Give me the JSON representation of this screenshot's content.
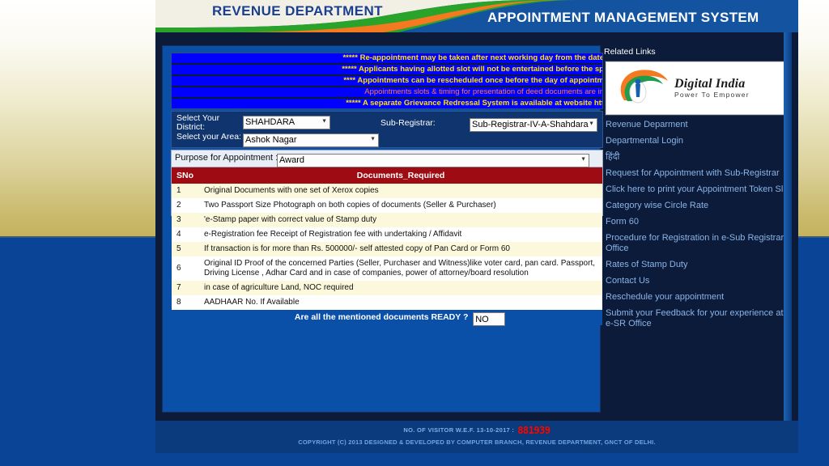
{
  "header": {
    "left_title": "REVENUE DEPARTMENT",
    "right_title": "APPOINTMENT MANAGEMENT SYSTEM"
  },
  "marquee": {
    "lines": [
      {
        "text": "***** Re-appointment may be taken after next working day from the date",
        "color": "#ffe400"
      },
      {
        "text": "***** Applicants having allotted slot will not be entertained before the sp",
        "color": "#ffe400"
      },
      {
        "text": "**** Appointments can be rescheduled once before the day of appointm",
        "color": "#ffe400"
      },
      {
        "text": "Appointments slots & timing for presentation of deed documents are in",
        "color": "#ff7b3d"
      },
      {
        "text": "***** A separate Grievance Redressal System is available at website htt",
        "color": "#ffe400"
      }
    ]
  },
  "selectors": {
    "district_label": "Select Your District:",
    "district_value": "SHAHDARA",
    "subregistrar_label": "Sub-Registrar:",
    "subregistrar_value": "Sub-Registrar-IV-A-Shahdara",
    "area_label": "Select your Area:",
    "area_value": "Ashok Nagar"
  },
  "purpose": {
    "label": "Purpose for Appointment :",
    "value": "Award"
  },
  "documents_table": {
    "headers": [
      "SNo",
      "Documents_Required"
    ],
    "rows": [
      {
        "sno": "1",
        "doc": "Original Documents with one set of Xerox copies"
      },
      {
        "sno": "2",
        "doc": "Two Passport Size Photograph on both copies of documents (Seller & Purchaser)"
      },
      {
        "sno": "3",
        "doc": "'e-Stamp paper with correct value of Stamp duty"
      },
      {
        "sno": "4",
        "doc": "e-Registration fee Receipt of Registration fee with undertaking / Affidavit"
      },
      {
        "sno": "5",
        "doc": "If transaction is for more than Rs. 500000/- self attested copy of Pan Card or Form 60"
      },
      {
        "sno": "6",
        "doc": "Original ID Proof of the concerned Parties (Seller, Purchaser and Witness)like voter card, pan card. Passport, Driving License , Adhar Card and in case of companies, power of attorney/board resolution"
      },
      {
        "sno": "7",
        "doc": "in case of agriculture Land, NOC required"
      },
      {
        "sno": "8",
        "doc": "AADHAAR No. If Available"
      }
    ]
  },
  "ready": {
    "label": "Are all the  mentioned documents READY ?",
    "value": "NO"
  },
  "sidebar": {
    "title": "Related Links",
    "logo": {
      "name": "Digital India",
      "tagline": "Power To Empower"
    },
    "links": [
      {
        "label": "Revenue Deparment"
      },
      {
        "label": "Departmental Login"
      },
      {
        "label": "हिंदी"
      },
      {
        "label": "Request for Appointment with Sub-Registrar"
      },
      {
        "label": "Click here to print your Appointment Token Slip"
      },
      {
        "label": "Category wise Circle Rate"
      },
      {
        "label": "Form 60"
      },
      {
        "label": "Procedure for Registration in e-Sub Registrar Office"
      },
      {
        "label": "Rates of Stamp Duty"
      },
      {
        "label": "Contact Us"
      },
      {
        "label": "Reschedule your appointment"
      },
      {
        "label": "Submit your Feedback for your experience at e-SR Office"
      }
    ]
  },
  "footer": {
    "visitor_label": "NO. OF VISITOR W.E.F. 13-10-2017 :",
    "visitor_count": "881939",
    "copyright": "COPYRIGHT (C) 2013 DESIGNED & DEVELOPED BY COMPUTER BRANCH, REVENUE DEPARTMENT, GNCT OF DELHI."
  },
  "colors": {
    "accent_blue": "#0a4fa8",
    "panel_navy": "#0b1b39",
    "header_red": "#9e0b12",
    "marquee_bg": "#0000ff",
    "marquee_yellow": "#ffe400",
    "marquee_orange": "#ff7b3d",
    "link_blue": "#8ab4e8",
    "counter_red": "#e01010"
  }
}
